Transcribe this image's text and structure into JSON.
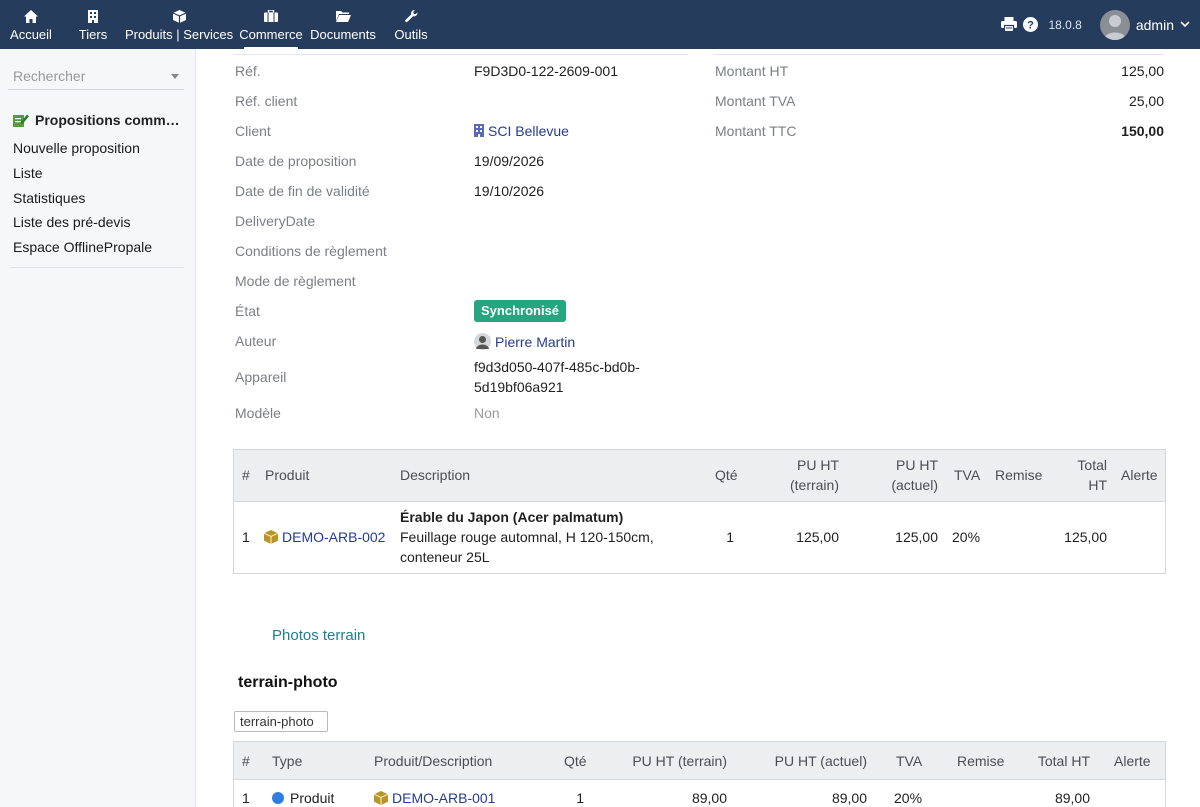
{
  "topbar": {
    "nav": [
      {
        "label": "Accueil",
        "icon": "home-icon"
      },
      {
        "label": "Tiers",
        "icon": "building-icon"
      },
      {
        "label": "Produits | Services",
        "icon": "cube-icon"
      },
      {
        "label": "Commerce",
        "icon": "briefcase-icon"
      },
      {
        "label": "Documents",
        "icon": "folder-icon"
      },
      {
        "label": "Outils",
        "icon": "wrench-icon"
      }
    ],
    "active_nav": "Commerce",
    "version": "18.0.8",
    "username": "admin",
    "bar_color": "#263c5c"
  },
  "sidebar": {
    "search_placeholder": "Rechercher",
    "menu_title": "Propositions comm…",
    "links": [
      "Nouvelle proposition",
      "Liste",
      "Statistiques",
      "Liste des pré-devis",
      "Espace OfflinePropale"
    ]
  },
  "details": {
    "ref_label": "Réf.",
    "ref_value": "F9D3D0-122-2609-001",
    "ref_client_label": "Réf. client",
    "client_label": "Client",
    "client_value": "SCI Bellevue",
    "date_label": "Date de proposition",
    "date_value": "19/09/2026",
    "end_date_label": "Date de fin de validité",
    "end_date_value": "19/10/2026",
    "delivery_label": "DeliveryDate",
    "conditions_label": "Conditions de règlement",
    "mode_label": "Mode de règlement",
    "state_label": "État",
    "state_value": "Synchronisé",
    "state_color": "#25a580",
    "author_label": "Auteur",
    "author_value": "Pierre Martin",
    "device_label": "Appareil",
    "device_value_line1": "f9d3d050-407f-485c-bd0b-",
    "device_value_line2": "5d19bf06a921",
    "model_label": "Modèle",
    "model_value": "Non"
  },
  "amounts": {
    "ht_label": "Montant HT",
    "ht_value": "125,00",
    "tva_label": "Montant TVA",
    "tva_value": "25,00",
    "ttc_label": "Montant TTC",
    "ttc_value": "150,00"
  },
  "lines_table": {
    "headers": {
      "num": "#",
      "product": "Produit",
      "description": "Description",
      "qty": "Qté",
      "pu_terrain_1": "PU HT",
      "pu_terrain_2": "(terrain)",
      "pu_actuel_1": "PU HT",
      "pu_actuel_2": "(actuel)",
      "tva": "TVA",
      "remise": "Remise",
      "total_1": "Total",
      "total_2": "HT",
      "alerte": "Alerte"
    },
    "rows": [
      {
        "num": "1",
        "product": "DEMO-ARB-002",
        "desc_title": "Érable du Japon (Acer palmatum)",
        "desc_line1": "Feuillage rouge automnal, H 120-150cm,",
        "desc_line2": "conteneur 25L",
        "qty": "1",
        "pu_terrain": "125,00",
        "pu_actuel": "125,00",
        "tva": "20%",
        "remise": "",
        "total": "125,00",
        "alerte": ""
      }
    ]
  },
  "photos": {
    "link": "Photos terrain",
    "title": "terrain-photo",
    "img_alt": "terrain-photo"
  },
  "photo_table": {
    "headers": {
      "num": "#",
      "type": "Type",
      "product": "Produit/Description",
      "qty": "Qté",
      "pu_terrain": "PU HT (terrain)",
      "pu_actuel": "PU HT (actuel)",
      "tva": "TVA",
      "remise": "Remise",
      "total": "Total HT",
      "alerte": "Alerte"
    },
    "rows": [
      {
        "num": "1",
        "type": "Produit",
        "product": "DEMO-ARB-001",
        "qty": "1",
        "pu_terrain": "89,00",
        "pu_actuel": "89,00",
        "tva": "20%",
        "remise": "",
        "total": "89,00",
        "alerte": ""
      }
    ]
  }
}
